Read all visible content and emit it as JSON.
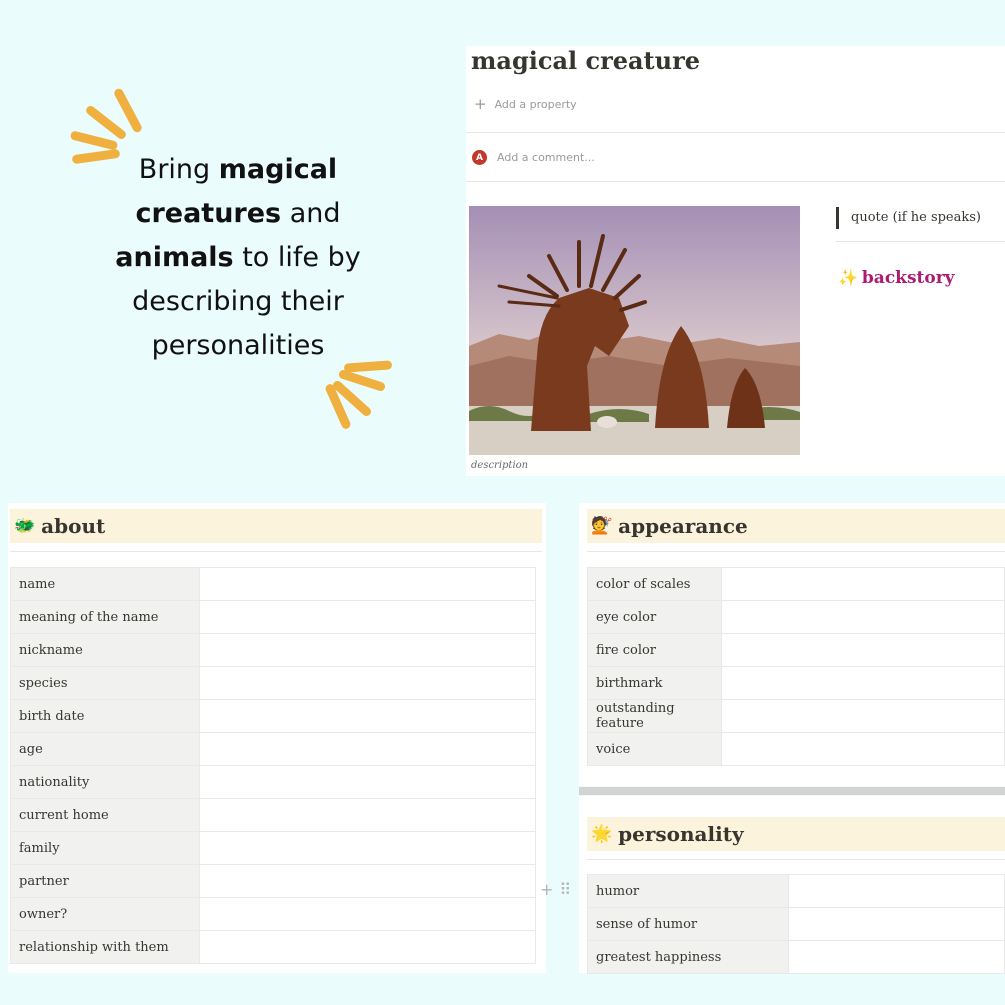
{
  "promo": {
    "line1_plain": "Bring ",
    "line1_bold": "magical",
    "line2_bold": "creatures",
    "line2_plain": " and",
    "line3_bold": "animals",
    "line3_plain": " to life by",
    "line4": "describing their",
    "line5": "personalities"
  },
  "page": {
    "title": "magical creature",
    "add_property": "Add a property",
    "avatar_letter": "A",
    "add_comment": "Add a comment...",
    "image_caption": "description",
    "quote": "quote (if he speaks)",
    "backstory": "backstory"
  },
  "about": {
    "title": "about",
    "rows": [
      "name",
      "meaning of the name",
      "nickname",
      "species",
      "birth date",
      "age",
      "nationality",
      "current home",
      "family",
      "partner",
      "owner?",
      "relationship with them"
    ]
  },
  "appearance": {
    "title": "appearance",
    "rows": [
      "color of scales",
      "eye color",
      "fire color",
      "birthmark",
      "outstanding feature",
      "voice"
    ]
  },
  "personality": {
    "title": "personality",
    "rows": [
      "humor",
      "sense of humor",
      "greatest happiness"
    ]
  },
  "colors": {
    "background": "#eafcfc",
    "header_bg": "#fbf3db",
    "accent_rays": "#f0b040",
    "backstory": "#ad1a72"
  },
  "icons": {
    "about": "dragon-icon",
    "appearance": "woman-icon",
    "personality": "shooting-star-icon",
    "backstory": "sparkles-icon"
  }
}
